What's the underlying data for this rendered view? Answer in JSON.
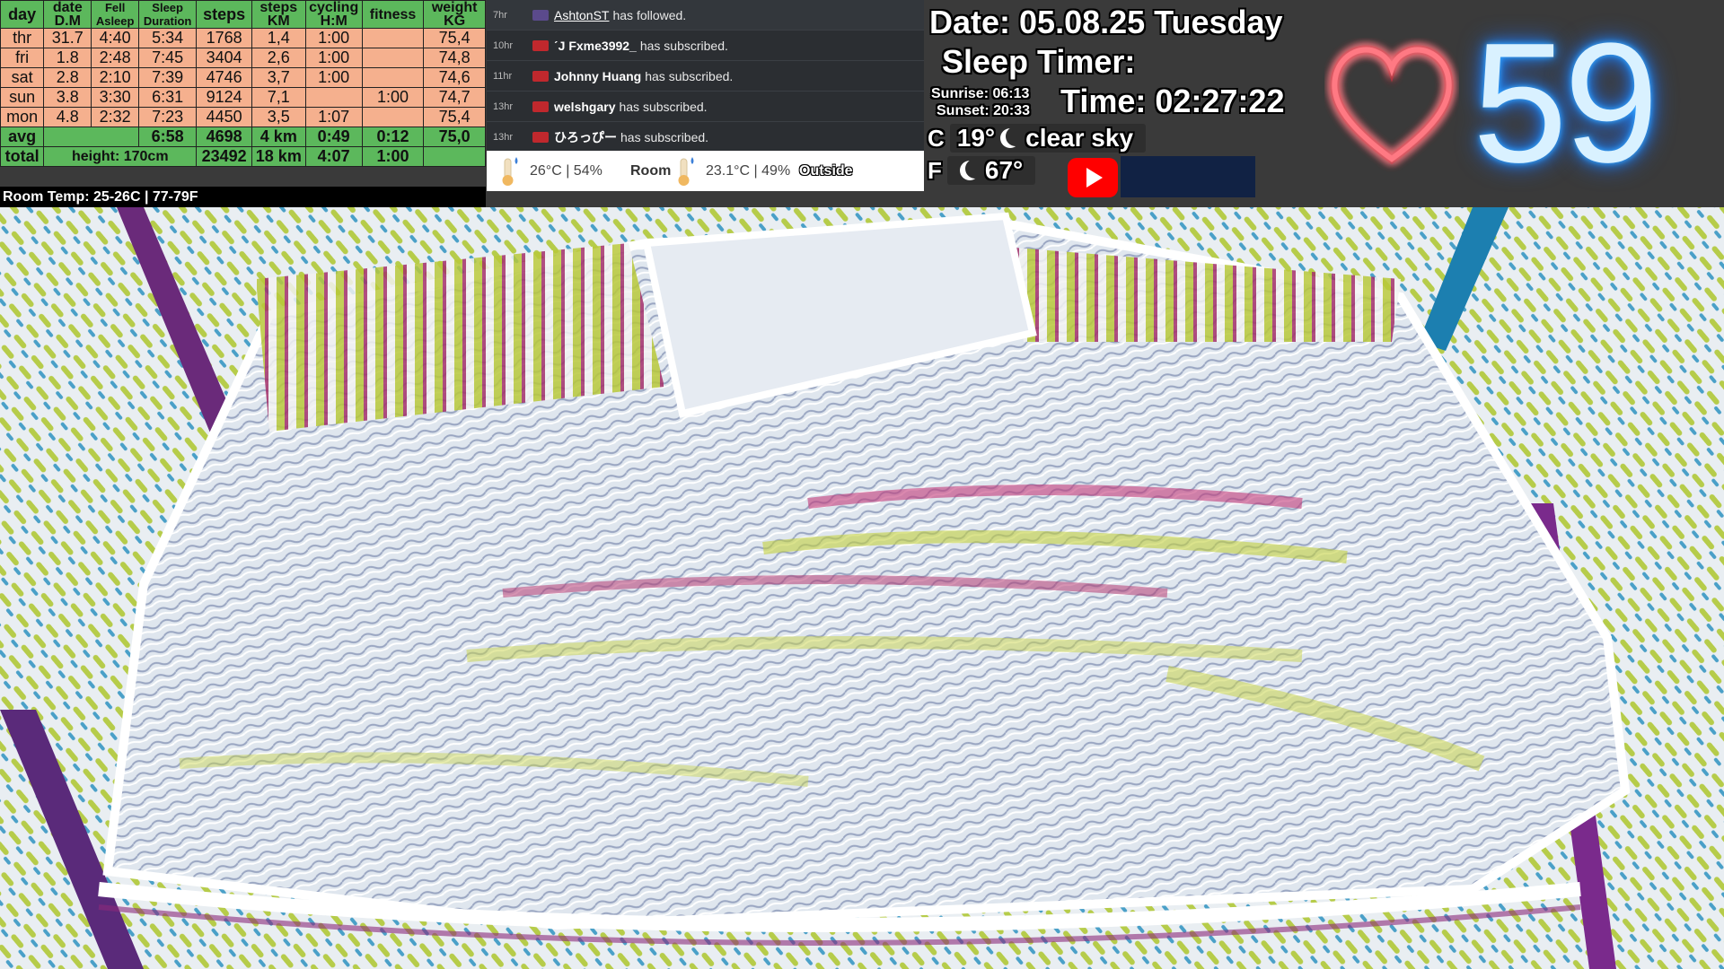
{
  "stats_table": {
    "headers": [
      {
        "line1": "day",
        "line2": ""
      },
      {
        "line1": "date",
        "line2": "D.M"
      },
      {
        "line1": "Fell",
        "line2": "Asleep"
      },
      {
        "line1": "Sleep",
        "line2": "Duration"
      },
      {
        "line1": "steps",
        "line2": ""
      },
      {
        "line1": "steps",
        "line2": "KM"
      },
      {
        "line1": "cycling",
        "line2": "H:M"
      },
      {
        "line1": "fitness",
        "line2": ""
      },
      {
        "line1": "weight",
        "line2": "KG"
      }
    ],
    "rows": [
      [
        "thr",
        "31.7",
        "4:40",
        "5:34",
        "1768",
        "1,4",
        "1:00",
        "",
        "75,4"
      ],
      [
        "fri",
        "1.8",
        "2:48",
        "7:45",
        "3404",
        "2,6",
        "1:00",
        "",
        "74,8"
      ],
      [
        "sat",
        "2.8",
        "2:10",
        "7:39",
        "4746",
        "3,7",
        "1:00",
        "",
        "74,6"
      ],
      [
        "sun",
        "3.8",
        "3:30",
        "6:31",
        "9124",
        "7,1",
        "",
        "1:00",
        "74,7"
      ],
      [
        "mon",
        "4.8",
        "2:32",
        "7:23",
        "4450",
        "3,5",
        "1:07",
        "",
        "75,4"
      ]
    ],
    "avg": {
      "label": "avg",
      "sleep": "6:58",
      "steps": "4698",
      "km": "4 km",
      "cycling": "0:49",
      "fitness": "0:12",
      "weight": "75,0"
    },
    "total": {
      "label": "total",
      "height": "height: 170cm",
      "steps": "23492",
      "km": "18 km",
      "cycling": "4:07",
      "fitness": "1:00"
    }
  },
  "room_temp": "Room Temp: 25-26C | 77-79F",
  "feed": [
    {
      "time": "7hr",
      "user": "AshtonST",
      "action": "has followed.",
      "icon_color": "#5b4a8c"
    },
    {
      "time": "10hr",
      "user": "ˊJ Fxme3992_",
      "action": "has subscribed.",
      "icon_color": "#c0282d"
    },
    {
      "time": "11hr",
      "user": "Johnny Huang",
      "action": "has subscribed.",
      "icon_color": "#c0282d"
    },
    {
      "time": "13hr",
      "user": "welshgary",
      "action": "has subscribed.",
      "icon_color": "#c0282d"
    },
    {
      "time": "13hr",
      "user": "ひろっぴー",
      "action": "has subscribed.",
      "icon_color": "#c0282d"
    }
  ],
  "temps": {
    "room_value": "26°C | 54%",
    "room_label": "Room",
    "outside_value": "23.1°C | 49%",
    "outside_label": "Outside"
  },
  "clock": {
    "date": "Date: 05.08.25 Tuesday",
    "sleep_timer": "Sleep Timer:",
    "sunrise": "Sunrise: 06:13",
    "sunset": "Sunset: 20:33",
    "time": "Time: 02:27:22"
  },
  "weather": {
    "c_unit": "C",
    "c_temp": "19°",
    "condition": "clear sky",
    "f_unit": "F",
    "f_temp": "67°"
  },
  "heart_rate": "59",
  "colors": {
    "table_header": "#5cb85c",
    "table_row": "#f5b08e",
    "heart_neon": "#ff2a3a",
    "bpm_neon": "#1e90ff",
    "youtube": "#ff0000"
  },
  "icons": [
    "thermometer-icon",
    "moon-icon",
    "youtube-icon",
    "heart-icon"
  ]
}
